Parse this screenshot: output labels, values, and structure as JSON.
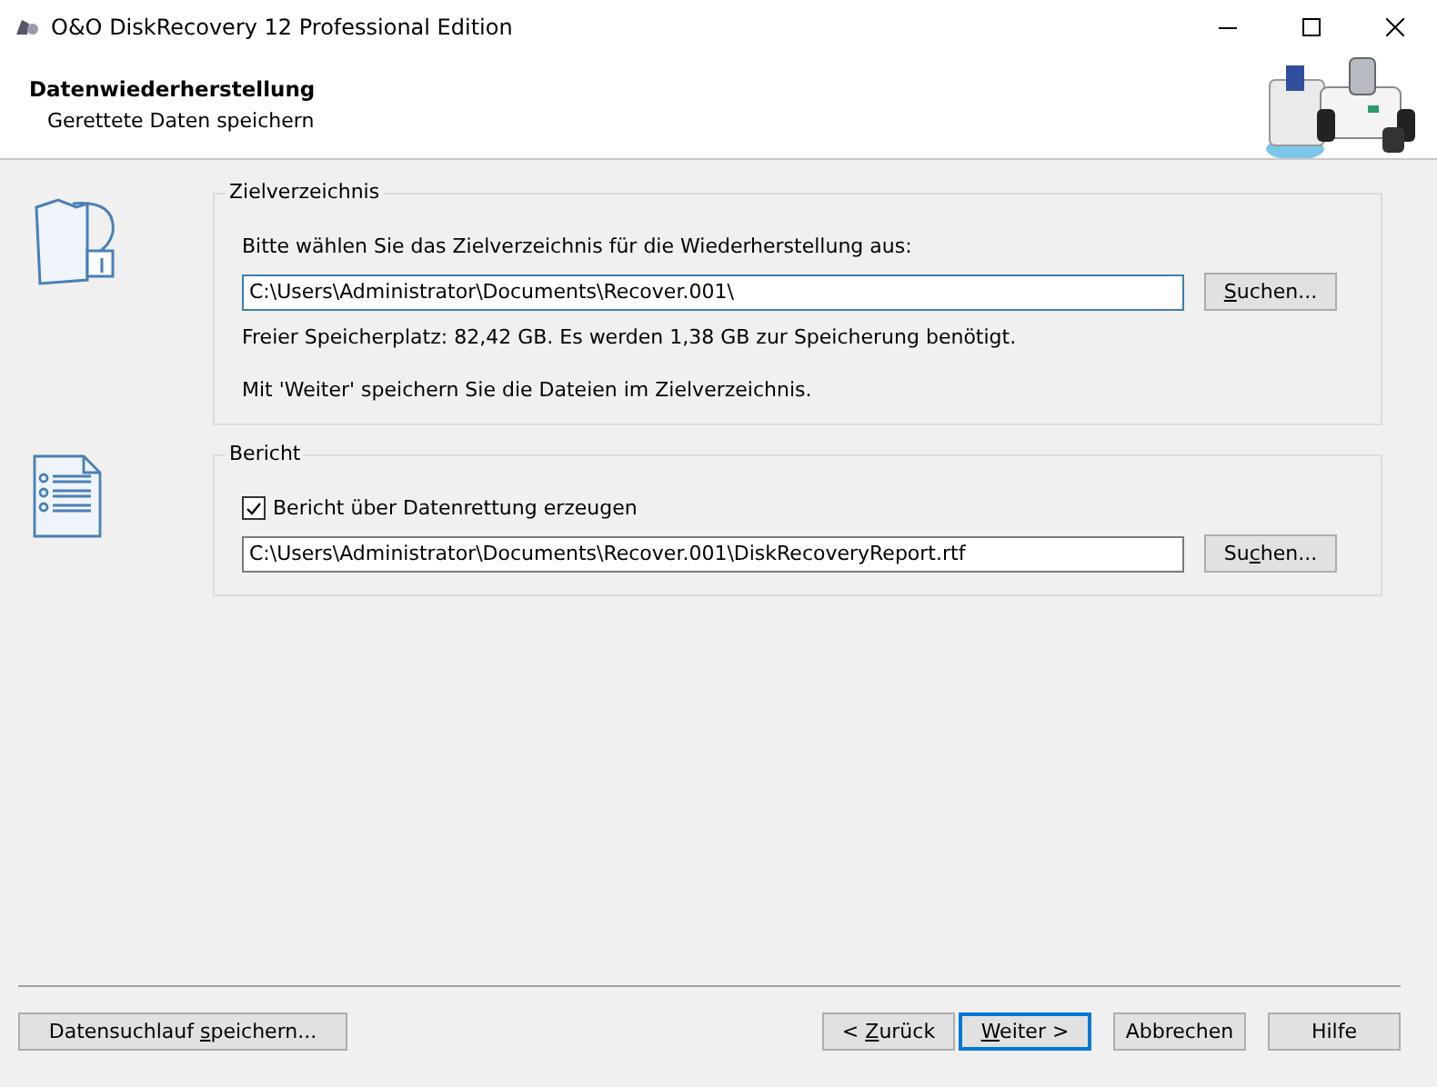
{
  "window": {
    "title": "O&O DiskRecovery 12 Professional Edition"
  },
  "header": {
    "title": "Datenwiederherstellung",
    "subtitle": "Gerettete Daten speichern"
  },
  "groups": [
    {
      "kind": "target",
      "title": "Zielverzeichnis",
      "prompt": "Bitte wählen Sie das Zielverzeichnis für die Wiederherstellung aus:",
      "field": {
        "value": "C:\\Users\\Administrator\\Documents\\Recover.001\\",
        "focused": true
      },
      "button": {
        "key": "S",
        "post": "uchen..."
      },
      "notes": [
        "Freier Speicherplatz: 82,42 GB. Es werden 1,38 GB zur Speicherung benötigt.",
        "Mit 'Weiter' speichern Sie die Dateien im Zielverzeichnis."
      ]
    },
    {
      "kind": "report",
      "title": "Bericht",
      "checkbox": {
        "label": "Bericht über Datenrettung erzeugen",
        "checked": true
      },
      "field": {
        "value": "C:\\Users\\Administrator\\Documents\\Recover.001\\DiskRecoveryReport.rtf",
        "focused": false
      },
      "button": {
        "pre": "Su",
        "key": "c",
        "post": "hen..."
      }
    }
  ],
  "footer": {
    "left_button": {
      "pre": "Datensuchlauf ",
      "key": "s",
      "post": "peichern..."
    },
    "buttons": [
      {
        "pre": "< ",
        "key": "Z",
        "post": "urück",
        "default": false
      },
      {
        "key": "W",
        "post": "eiter >",
        "default": true
      },
      {
        "pre": "Abbrechen",
        "default": false
      },
      {
        "pre": "Hilfe",
        "default": false
      }
    ]
  }
}
